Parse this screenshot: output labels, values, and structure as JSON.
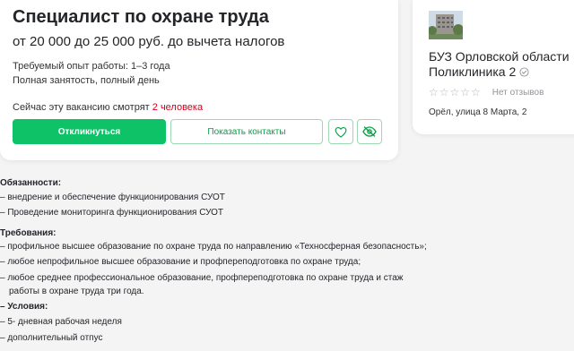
{
  "vacancy": {
    "title": "Специалист по охране труда",
    "salary": "от 20 000 до 25 000 руб. до вычета налогов",
    "experience": "Требуемый опыт работы: 1–3 года",
    "employment": "Полная занятость, полный день",
    "viewers_prefix": "Сейчас эту вакансию смотрят ",
    "viewers_count": "2 человека",
    "respond_label": "Откликнуться",
    "contacts_label": "Показать контакты",
    "favorite_icon": "heart-icon",
    "hide_icon": "eye-off-icon"
  },
  "employer": {
    "name_line1": "БУЗ Орловской области",
    "name_line2": "Поликлиника 2",
    "verified_icon": "check-circle-icon",
    "stars": "☆☆☆☆☆",
    "reviews": "Нет отзывов",
    "address": "Орёл, улица 8 Марта, 2"
  },
  "description": {
    "duties_title": "Обязанности:",
    "duties": [
      "– внедрение и обеспечение функционирования СУОТ",
      "– Проведение мониторинга функционирования СУОТ"
    ],
    "requirements_title": "Требования:",
    "requirements": [
      "– профильное высшее образование по охране труда по направлению «Техносферная безопасность»;",
      "– любое непрофильное высшее образование и профпереподготовка по охране труда;",
      "– любое среднее профессиональное образование, профпереподготовка по охране труда и стаж",
      "работы в охране труда три года."
    ],
    "conditions_title": "– Условия:",
    "conditions": [
      "– 5- дневная рабочая неделя",
      "– дополнительный отпус"
    ]
  },
  "colors": {
    "accent": "#0dc267",
    "accent_text": "#0a9e47",
    "highlight": "#d6001c"
  }
}
